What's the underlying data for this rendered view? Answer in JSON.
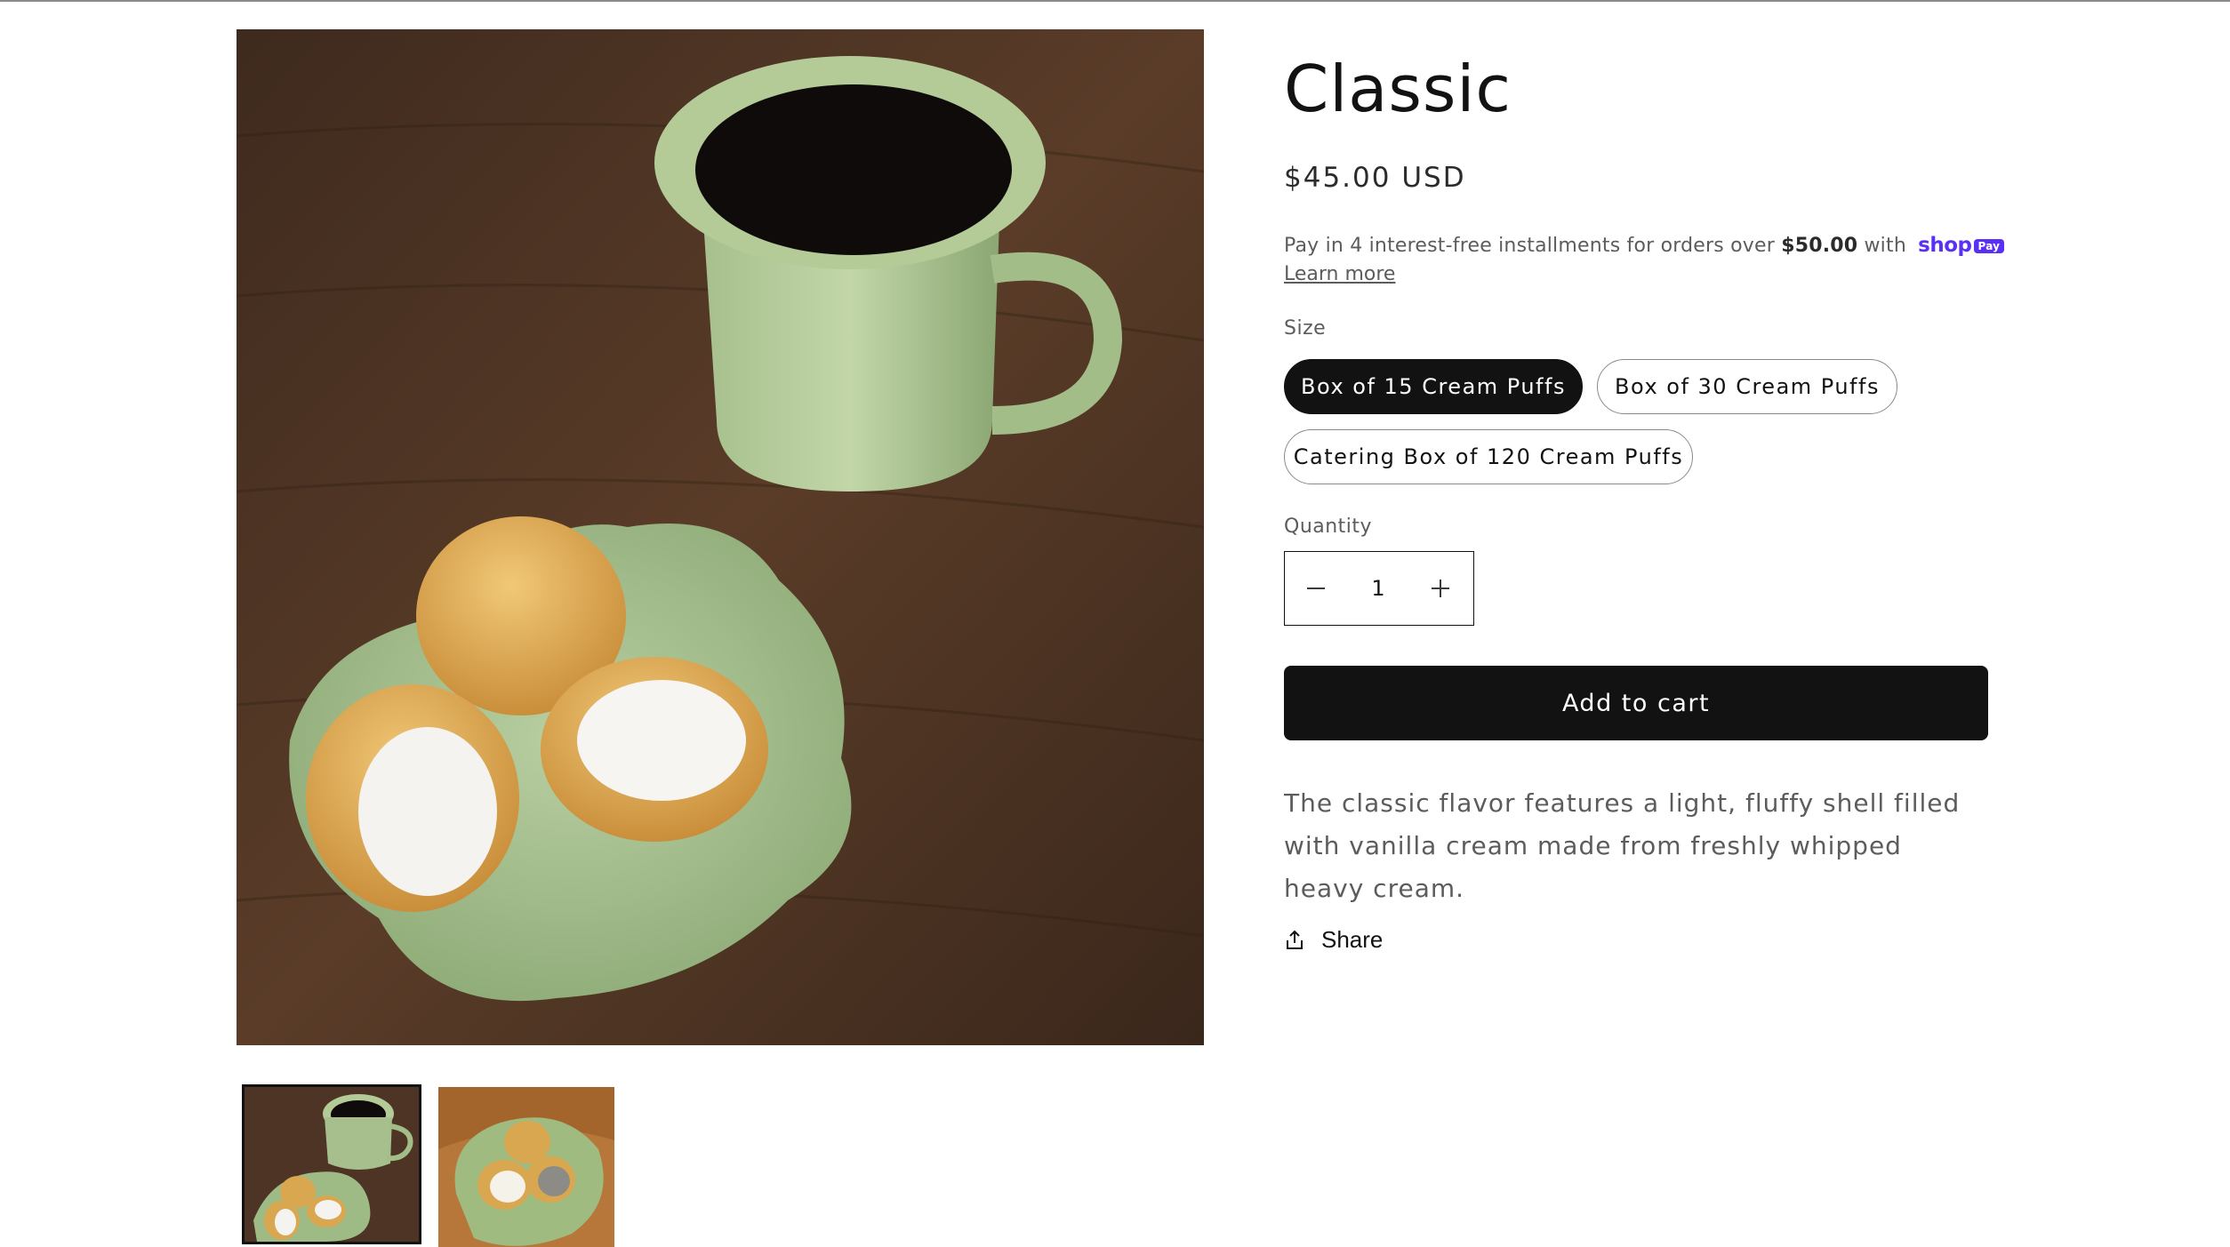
{
  "product": {
    "title": "Classic",
    "price": "$45.00 USD",
    "installments": {
      "text_before": "Pay in 4 interest-free installments for orders over ",
      "threshold": "$50.00",
      "text_after": " with",
      "provider_logo": "shop",
      "provider_badge": "Pay",
      "learn_more": "Learn more"
    },
    "size": {
      "label": "Size",
      "options": [
        "Box of 15 Cream Puffs",
        "Box of 30 Cream Puffs",
        "Catering Box of 120 Cream Puffs"
      ],
      "selected": "Box of 15 Cream Puffs"
    },
    "quantity": {
      "label": "Quantity",
      "value": "1",
      "decrement_icon": "minus-icon",
      "increment_icon": "plus-icon"
    },
    "add_to_cart": "Add to cart",
    "description": "The classic flavor features a light, fluffy shell filled with vanilla cream made from freshly whipped heavy cream.",
    "share": {
      "label": "Share",
      "icon": "share-icon"
    }
  },
  "gallery": {
    "selected_index": 0,
    "thumbnail_count": 2
  },
  "colors": {
    "text": "#121212",
    "muted": "#5c5c5c",
    "button_bg": "#121212",
    "shop_pay_purple": "#5a31f4"
  }
}
